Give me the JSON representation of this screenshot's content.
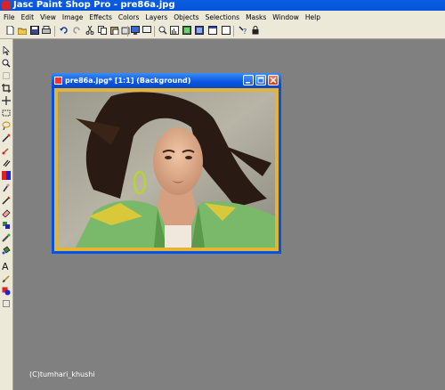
{
  "app": {
    "title": "Jasc Paint Shop Pro - pre86a.jpg"
  },
  "menu": [
    "File",
    "Edit",
    "View",
    "Image",
    "Effects",
    "Colors",
    "Layers",
    "Objects",
    "Selections",
    "Masks",
    "Window",
    "Help"
  ],
  "toolbar": {
    "icons": [
      "new-icon",
      "open-icon",
      "save-icon",
      "print-icon",
      "undo-icon",
      "redo-icon",
      "cut-icon",
      "copy-icon",
      "paste-icon",
      "delete-icon",
      "browse-icon",
      "screen-icon",
      "zoom-icon",
      "histogram-icon",
      "layers-icon",
      "overview-icon",
      "tool-options-icon",
      "help-icon",
      "lock-icon"
    ]
  },
  "tools": [
    "arrow-tool-icon",
    "zoom-tool-icon",
    "deform-tool-icon",
    "crop-tool-icon",
    "move-tool-icon",
    "selection-tool-icon",
    "lasso-tool-icon",
    "dropper-tool-icon",
    "paintbrush-tool-icon",
    "clone-tool-icon",
    "color-replacer-tool-icon",
    "retouch-tool-icon",
    "scratch-remover-tool-icon",
    "eraser-tool-icon",
    "picture-tube-tool-icon",
    "airbrush-tool-icon",
    "flood-fill-tool-icon",
    "text-tool-icon",
    "draw-tool-icon",
    "preset-shapes-tool-icon",
    "object-selector-tool-icon"
  ],
  "document": {
    "title": "pre86a.jpg* [1:1] (Background)"
  },
  "watermark": "(C)tumhari_khushi",
  "colors": {
    "titlebar": "#0a5ee0",
    "workspace": "#808080",
    "chrome": "#ece9d8",
    "image_border": "#e3b436"
  }
}
